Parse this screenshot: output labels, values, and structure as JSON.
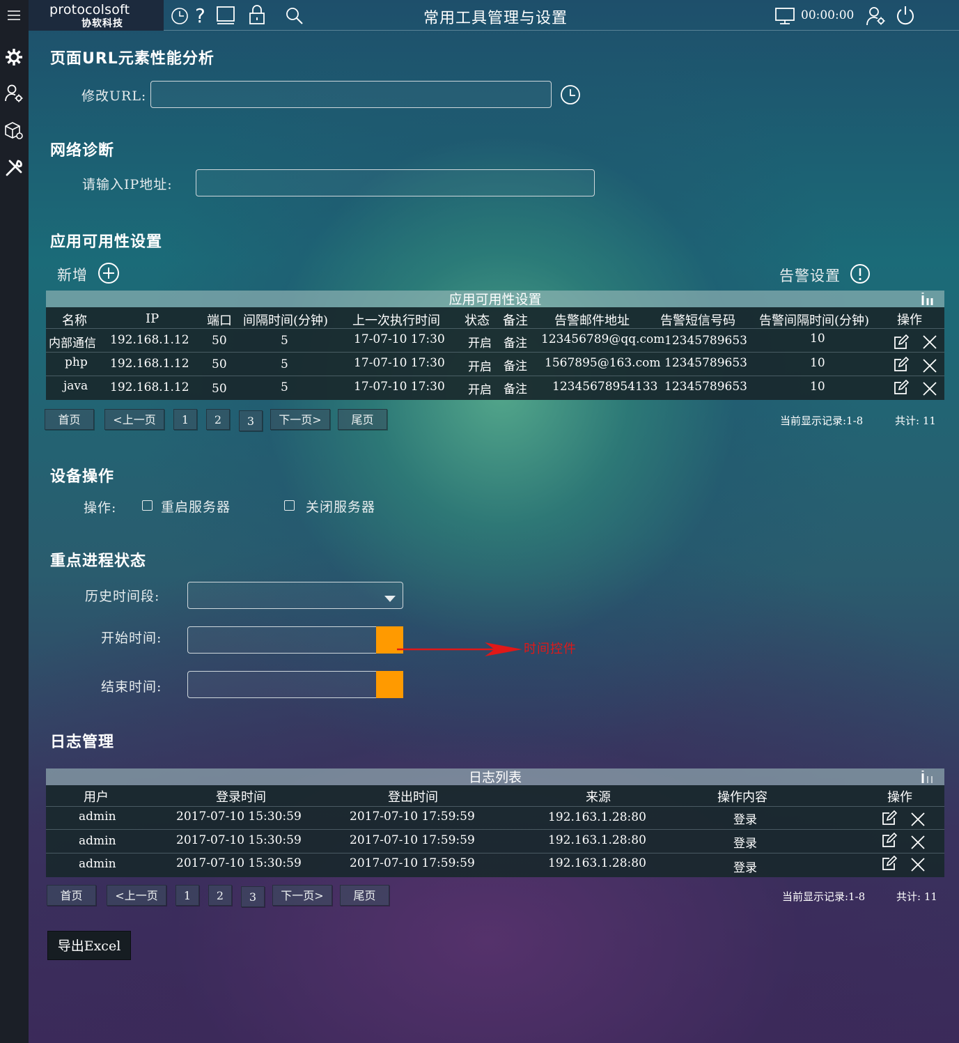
{
  "header": {
    "logo_top": "protocolsoft",
    "logo_bottom": "协软科技",
    "title": "常用工具管理与设置",
    "clock": "00:00:00"
  },
  "url_analysis": {
    "title": "页面URL元素性能分析",
    "label": "修改URL:",
    "value": ""
  },
  "network": {
    "title": "网络诊断",
    "label": "请输入IP地址:",
    "value": ""
  },
  "availability": {
    "title": "应用可用性设置",
    "add_label": "新增",
    "alert_label": "告警设置",
    "table_caption": "应用可用性设置",
    "columns": [
      "名称",
      "IP",
      "端口",
      "间隔时间(分钟)",
      "上一次执行时间",
      "状态",
      "备注",
      "告警邮件地址",
      "告警短信号码",
      "告警间隔时间(分钟)",
      "操作"
    ],
    "rows": [
      {
        "name": "内部通信",
        "ip": "192.168.1.12",
        "port": "50",
        "interval": "5",
        "last_run": "17-07-10 17:30",
        "status": "开启",
        "note": "备注",
        "email": "123456789@qq.com",
        "sms": "12345789653",
        "alert_interval": "10"
      },
      {
        "name": "php",
        "ip": "192.168.1.12",
        "port": "50",
        "interval": "5",
        "last_run": "17-07-10 17:30",
        "status": "开启",
        "note": "备注",
        "email": "1567895@163.com",
        "sms": "12345789653",
        "alert_interval": "10"
      },
      {
        "name": "java",
        "ip": "192.168.1.12",
        "port": "50",
        "interval": "5",
        "last_run": "17-07-10 17:30",
        "status": "开启",
        "note": "备注",
        "email": "12345678954133",
        "sms": "12345789653",
        "alert_interval": "10"
      }
    ],
    "pager": {
      "first": "首页",
      "prev": "<上一页",
      "pages": [
        "1",
        "2",
        "3"
      ],
      "next": "下一页>",
      "last": "尾页"
    },
    "record_info": "当前显示记录:1-8",
    "total_info": "共计: 11"
  },
  "device": {
    "title": "设备操作",
    "label": "操作:",
    "options": [
      "重启服务器",
      "关闭服务器"
    ]
  },
  "process": {
    "title": "重点进程状态",
    "history_label": "历史时间段:",
    "start_label": "开始时间:",
    "end_label": "结束时间:",
    "annotation": "时间控件",
    "annotation_color": "#e01818",
    "accent_color": "#ff9a00"
  },
  "logs": {
    "title": "日志管理",
    "table_caption": "日志列表",
    "columns": [
      "用户",
      "登录时间",
      "登出时间",
      "来源",
      "操作内容",
      "操作"
    ],
    "rows": [
      {
        "user": "admin",
        "login": "2017-07-10 15:30:59",
        "logout": "2017-07-10 17:59:59",
        "source": "192.163.1.28:80",
        "action": "登录"
      },
      {
        "user": "admin",
        "login": "2017-07-10 15:30:59",
        "logout": "2017-07-10 17:59:59",
        "source": "192.163.1.28:80",
        "action": "登录"
      },
      {
        "user": "admin",
        "login": "2017-07-10 15:30:59",
        "logout": "2017-07-10 17:59:59",
        "source": "192.163.1.28:80",
        "action": "登录"
      }
    ],
    "pager": {
      "first": "首页",
      "prev": "<上一页",
      "pages": [
        "1",
        "2",
        "3"
      ],
      "next": "下一页>",
      "last": "尾页"
    },
    "record_info": "当前显示记录:1-8",
    "total_info": "共计: 11",
    "export_label": "导出Excel"
  },
  "icons": {
    "menu": "hamburger-icon",
    "history": "clock-icon",
    "help": "question-icon",
    "screen": "screen-icon",
    "lock": "lock-icon",
    "search": "search-icon",
    "monitor": "monitor-icon",
    "user_settings": "user-gear-icon",
    "power": "power-icon",
    "settings": "gear-icon",
    "user_config": "user-config-icon",
    "packages": "cubes-icon",
    "tools": "tools-icon",
    "edit": "edit-icon",
    "delete": "close-icon",
    "columns": "columns-icon",
    "add": "plus-circle-icon",
    "alert": "alert-circle-icon",
    "dropdown": "chevron-down-icon"
  }
}
